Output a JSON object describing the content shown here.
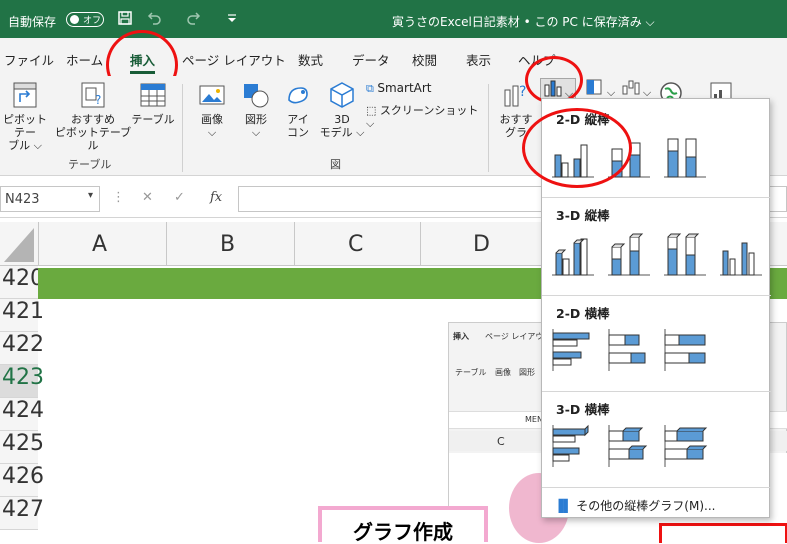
{
  "titlebar": {
    "autosave_label": "自動保存",
    "toggle_label": "オフ",
    "document_title": "寅うさのExcel日記素材 • この PC に保存済み ⌵"
  },
  "tabs": [
    "ファイル",
    "ホーム",
    "挿入",
    "ページ レイアウト",
    "数式",
    "データ",
    "校閲",
    "表示",
    "ヘルプ"
  ],
  "ribbon": {
    "pivot_label_1": "ピボットテー",
    "pivot_label_2": "ブル ⌵",
    "rec_pivot_1": "おすすめ",
    "rec_pivot_2": "ピボットテーブル",
    "table_label": "テーブル",
    "group_table": "テーブル",
    "image_label": "画像",
    "shape_label": "図形",
    "icon_label_1": "アイ",
    "icon_label_2": "コン",
    "model_label_1": "3D",
    "model_label_2": "モデル ⌵",
    "smartart_label": "SmartArt",
    "screenshot_label": "スクリーンショット ⌵",
    "group_figure": "図",
    "rec_chart_1": "おすす",
    "rec_chart_2": "グラ"
  },
  "formulabar": {
    "namebox": "N423",
    "cancel": "✕",
    "confirm": "✓",
    "fx": "fx"
  },
  "columns": [
    "A",
    "B",
    "C",
    "D"
  ],
  "rows": [
    "420",
    "421",
    "422",
    "423",
    "424",
    "425",
    "426",
    "427"
  ],
  "dropdown": {
    "section_2d_col": "2-D 縦棒",
    "section_3d_col": "3-D 縦棒",
    "section_2d_bar": "2-D 横棒",
    "section_3d_bar": "3-D 横棒",
    "more_link": "その他の縦棒グラフ(M)..."
  },
  "inset": {
    "tab_insert": "挿入",
    "tab_layout": "ページ レイアウト",
    "table": "テーブル",
    "image": "画像",
    "shape": "図形",
    "col_c": "C",
    "name_prefix": "MEN",
    "banner_text": "グラフ作成"
  },
  "colors": {
    "excel_green": "#217346",
    "band_green": "#6aaa3f",
    "bar_blue": "#5b9bd5",
    "highlight_red": "#e11111"
  }
}
